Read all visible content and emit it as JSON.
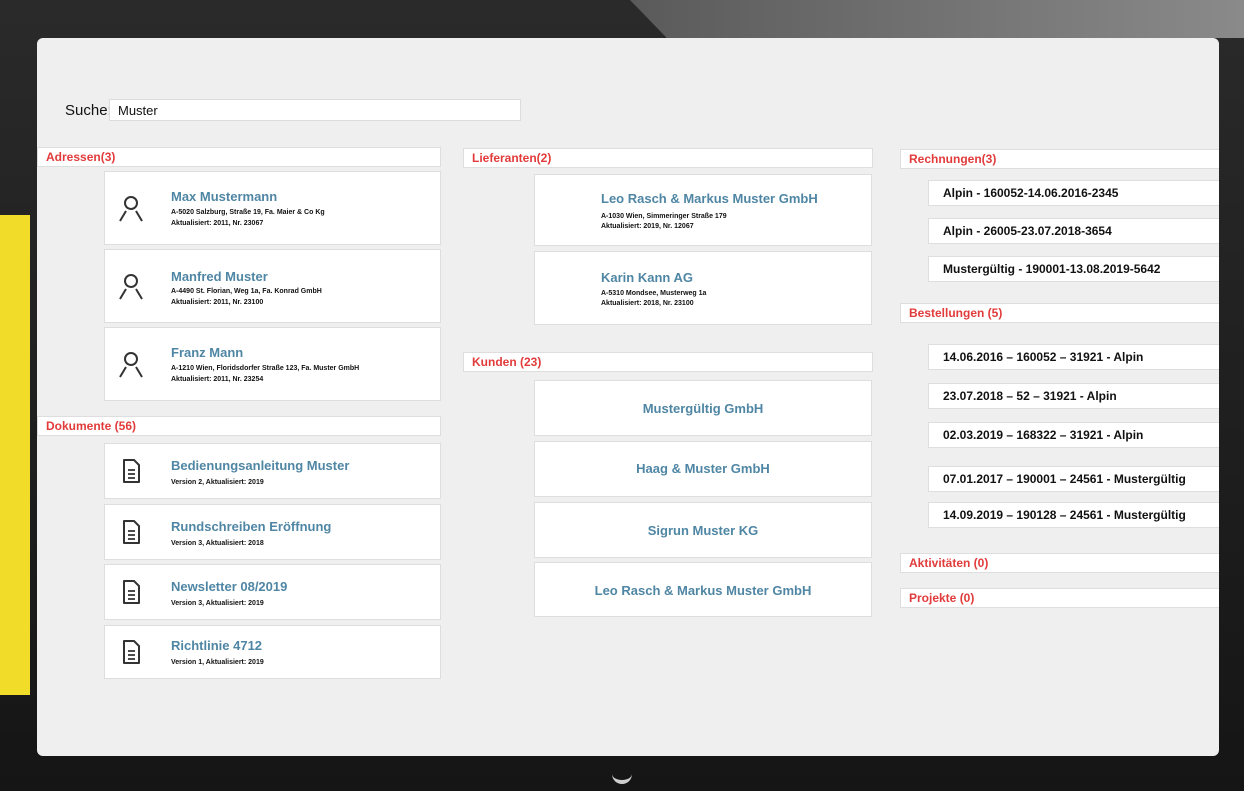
{
  "search": {
    "label": "Suche:",
    "value": "Muster"
  },
  "adressen": {
    "header": "Adressen(3)",
    "items": [
      {
        "name": "Max Mustermann",
        "line1": "A-5020 Salzburg, Straße 19, Fa. Maier & Co Kg",
        "line2": "Aktualisiert: 2011, Nr. 23067"
      },
      {
        "name": "Manfred Muster",
        "line1": "A-4490 St. Florian, Weg 1a, Fa. Konrad GmbH",
        "line2": "Aktualisiert: 2011, Nr. 23100"
      },
      {
        "name": "Franz Mann",
        "line1": "A-1210 Wien, Floridsdorfer Straße 123, Fa. Muster GmbH",
        "line2": "Aktualisiert: 2011, Nr. 23254"
      }
    ]
  },
  "dokumente": {
    "header": "Dokumente (56)",
    "items": [
      {
        "name": "Bedienungsanleitung Muster",
        "line1": "Version 2, Aktualisiert: 2019"
      },
      {
        "name": "Rundschreiben Eröffnung",
        "line1": "Version 3, Aktualisiert: 2018"
      },
      {
        "name": "Newsletter 08/2019",
        "line1": "Version 3, Aktualisiert: 2019"
      },
      {
        "name": "Richtlinie 4712",
        "line1": "Version 1, Aktualisiert: 2019"
      }
    ]
  },
  "lieferanten": {
    "header": "Lieferanten(2)",
    "items": [
      {
        "name": "Leo Rasch & Markus Muster GmbH",
        "line1": "A-1030 Wien,  Simmeringer Straße 179",
        "line2": "Aktualisiert: 2019, Nr. 12067"
      },
      {
        "name": "Karin Kann AG",
        "line1": "A-5310 Mondsee, Musterweg 1a",
        "line2": "Aktualisiert: 2018, Nr. 23100"
      }
    ]
  },
  "kunden": {
    "header": "Kunden (23)",
    "items": [
      {
        "name": "Mustergültig GmbH"
      },
      {
        "name": "Haag & Muster GmbH"
      },
      {
        "name": "Sigrun Muster KG"
      },
      {
        "name": "Leo Rasch & Markus Muster GmbH"
      }
    ]
  },
  "rechnungen": {
    "header": "Rechnungen(3)",
    "items": [
      "Alpin - 160052-14.06.2016-2345",
      "Alpin - 26005-23.07.2018-3654",
      "Mustergültig - 190001-13.08.2019-5642"
    ]
  },
  "bestellungen": {
    "header": "Bestellungen (5)",
    "items": [
      "14.06.2016 – 160052 – 31921 - Alpin",
      "23.07.2018 – 52 – 31921 - Alpin",
      "02.03.2019 – 168322 – 31921 - Alpin",
      "07.01.2017 – 190001 – 24561 - Mustergültig",
      "14.09.2019 – 190128 – 24561 - Mustergültig"
    ]
  },
  "aktivitaeten": {
    "header": "Aktivitäten (0)"
  },
  "projekte": {
    "header": "Projekte (0)"
  }
}
